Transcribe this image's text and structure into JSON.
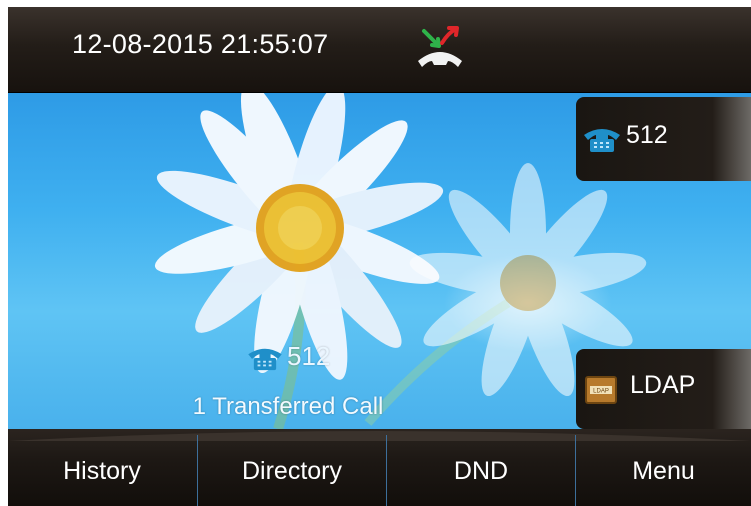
{
  "status_bar": {
    "datetime": "12-08-2015 21:55:07",
    "icons": [
      "handset-missed-call-icon"
    ]
  },
  "line_keys": [
    {
      "label": "512",
      "icon": "phone-icon"
    },
    {
      "label": "LDAP",
      "icon": "ldap-book-icon"
    }
  ],
  "notification": {
    "icon": "phone-icon",
    "number": "512",
    "message": "1 Transferred Call"
  },
  "softkeys": [
    {
      "label": "History"
    },
    {
      "label": "Directory"
    },
    {
      "label": "DND"
    },
    {
      "label": "Menu"
    }
  ],
  "colors": {
    "bar": "#1c1612",
    "wallpaper_sky": "#3fb0f0",
    "phone_icon": "#1f8fc9",
    "separator": "#3d6f9b"
  }
}
